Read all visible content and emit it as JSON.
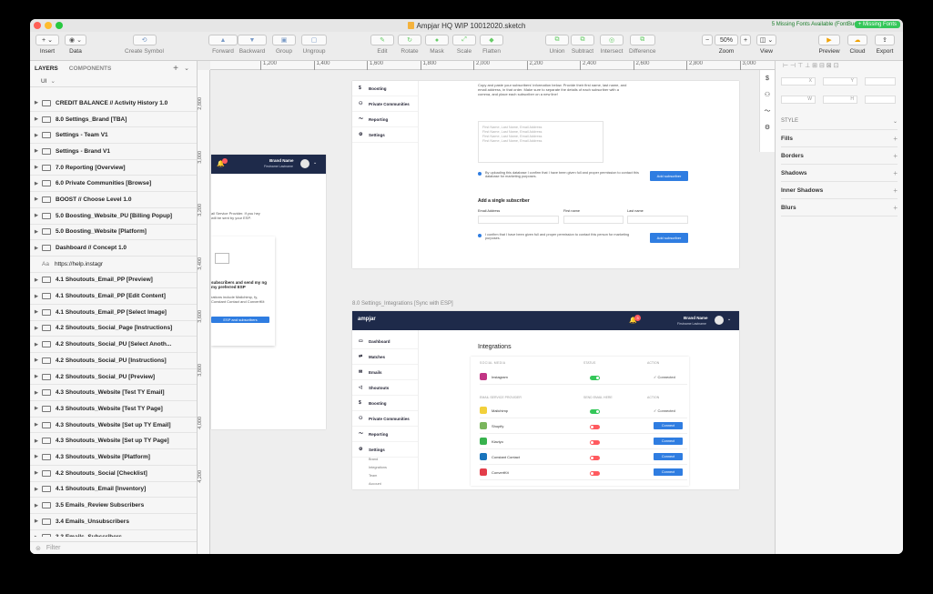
{
  "window": {
    "title": "Ampjar HQ WIP 10012020.sketch",
    "missing_fonts_text": "5 Missing Fonts Available (FontBuddy)",
    "missing_fonts_button": "+ Missing Fonts"
  },
  "toolbar": {
    "insert": "Insert",
    "data": "Data",
    "create_symbol": "Create Symbol",
    "forward": "Forward",
    "backward": "Backward",
    "group": "Group",
    "ungroup": "Ungroup",
    "edit": "Edit",
    "rotate": "Rotate",
    "mask": "Mask",
    "scale": "Scale",
    "flatten": "Flatten",
    "union": "Union",
    "subtract": "Subtract",
    "intersect": "Intersect",
    "difference": "Difference",
    "zoom_label": "Zoom",
    "zoom_value": "50%",
    "view": "View",
    "preview": "Preview",
    "cloud": "Cloud",
    "export": "Export"
  },
  "sidebar": {
    "tab_layers": "LAYERS",
    "tab_components": "COMPONENTS",
    "page": "UI",
    "filter_placeholder": "Filter",
    "layers": [
      {
        "name": "CREDIT BALANCE // Activity History 1.0",
        "type": "artboard"
      },
      {
        "name": "8.0 Settings_Brand [TBA]",
        "type": "artboard"
      },
      {
        "name": "Settings - Team V1",
        "type": "artboard"
      },
      {
        "name": "Settings - Brand V1",
        "type": "artboard"
      },
      {
        "name": "7.0 Reporting [Overview]",
        "type": "artboard"
      },
      {
        "name": "6.0 Private Communities [Browse]",
        "type": "artboard"
      },
      {
        "name": "BOOST // Choose Level 1.0",
        "type": "artboard"
      },
      {
        "name": "5.0 Boosting_Website_PU [Billing Popup]",
        "type": "artboard"
      },
      {
        "name": "5.0 Boosting_Website [Platform]",
        "type": "artboard"
      },
      {
        "name": "Dashboard // Concept 1.0",
        "type": "artboard"
      },
      {
        "name": "https://help.instagr",
        "type": "text"
      },
      {
        "name": "4.1 Shoutouts_Email_PP [Preview]",
        "type": "artboard"
      },
      {
        "name": "4.1 Shoutouts_Email_PP [Edit Content]",
        "type": "artboard"
      },
      {
        "name": "4.1 Shoutouts_Email_PP [Select Image]",
        "type": "artboard"
      },
      {
        "name": "4.2 Shoutouts_Social_Page [Instructions]",
        "type": "artboard"
      },
      {
        "name": "4.2 Shoutouts_Social_PU [Select Anoth...",
        "type": "artboard"
      },
      {
        "name": "4.2 Shoutouts_Social_PU [Instructions]",
        "type": "artboard"
      },
      {
        "name": "4.2 Shoutouts_Social_PU [Preview]",
        "type": "artboard"
      },
      {
        "name": "4.3 Shoutouts_Website [Test TY Email]",
        "type": "artboard"
      },
      {
        "name": "4.3 Shoutouts_Website [Test TY Page]",
        "type": "artboard"
      },
      {
        "name": "4.3 Shoutouts_Website [Set up TY Email]",
        "type": "artboard"
      },
      {
        "name": "4.3 Shoutouts_Website [Set up TY Page]",
        "type": "artboard"
      },
      {
        "name": "4.3 Shoutouts_Website [Platform]",
        "type": "artboard"
      },
      {
        "name": "4.2 Shoutouts_Social [Checklist]",
        "type": "artboard"
      },
      {
        "name": "4.1 Shoutouts_Email [Inventory]",
        "type": "artboard"
      },
      {
        "name": "3.5 Emails_Review Subscribers",
        "type": "artboard"
      },
      {
        "name": "3.4 Emails_Unsubscribers",
        "type": "artboard"
      },
      {
        "name": "3.3 Emails_Subscribers",
        "type": "artboard"
      }
    ]
  },
  "ruler": {
    "h_ticks": [
      "1,200",
      "1,400",
      "1,600",
      "1,800",
      "2,000",
      "2,200",
      "2,400",
      "2,600",
      "2,800",
      "3,000"
    ],
    "v_ticks": [
      "2,800",
      "3,000",
      "3,200",
      "3,400",
      "3,600",
      "3,800",
      "4,000",
      "4,200"
    ]
  },
  "artboards": {
    "left_frame": {
      "brand_name": "Brand Name",
      "brand_sub": "Firstname Lastname",
      "text_esp": "ail Service Provider. If you hey will be sent by your ESP.",
      "heading": "subscribers and send my ng my preferred ESP",
      "body": "rations include Mailchimp, fy, Constant Contact and ConvertKit",
      "cta": "ESP and subscribers"
    },
    "top_frame": {
      "nav": [
        "Boosting",
        "Private Communities",
        "Reporting",
        "Settings"
      ],
      "copy_paste_title": "Copy and paste",
      "instructions": "Copy and paste your subscribers' information below. Provide their first name, last name, and email address, in that order. Make sure to separate the details of each subscriber with a comma, and place each subscriber on a new line!",
      "textarea_lines": [
        "First Name, Last Name, Email Address",
        "First Name, Last Name, Email Address",
        "First Name, Last Name, Email Address",
        "First Name, Last Name, Email Address"
      ],
      "consent_1": "By uploading this database I confirm that I have been given full and proper permission to contact this database for marketing purposes.",
      "add_subscriber_btn": "Add subscriber",
      "single_title": "Add a single subscriber",
      "label_email": "Email Address",
      "label_first": "First name",
      "label_last": "Last name",
      "consent_2": "I confirm that I have been given full and proper permission to contact this person for marketing purposes.",
      "add_subscriber_btn_2": "Add subscriber"
    },
    "integrations_frame": {
      "artboard_title": "8.0 Settings_Integrations [Sync with ESP]",
      "logo": "ampjar",
      "notif_count": "3",
      "brand_name": "Brand Name",
      "brand_sub": "Firstname Lastname",
      "nav": [
        "Dashboard",
        "Matches",
        "Emails",
        "Shoutouts",
        "Boosting",
        "Private Communities",
        "Reporting",
        "Settings"
      ],
      "settings_sub": [
        "Brand",
        "Integrations",
        "Team",
        "Account"
      ],
      "heading": "Integrations",
      "social_header": "SOCIAL MEDIA",
      "status_header": "STATUS",
      "action_header": "ACTION",
      "esp_header": "EMAIL SERVICE PROVIDER",
      "send_header": "SEND EMAIL HERE",
      "action_header_2": "ACTION",
      "social": [
        {
          "name": "Instagram",
          "on": true,
          "action": "Connected",
          "color": "#c13584"
        }
      ],
      "esp": [
        {
          "name": "Mailchimp",
          "on": true,
          "action": "Connected",
          "color": "#f2d03b"
        },
        {
          "name": "Shopify",
          "on": false,
          "action": "Connect",
          "color": "#7ab55c"
        },
        {
          "name": "Klaviyo",
          "on": false,
          "action": "Connect",
          "color": "#37b24d"
        },
        {
          "name": "Constant Contact",
          "on": false,
          "action": "Connect",
          "color": "#1a75bc"
        },
        {
          "name": "ConvertKit",
          "on": false,
          "action": "Connect",
          "color": "#e33d4a"
        }
      ]
    }
  },
  "inspector": {
    "x_label": "X",
    "y_label": "Y",
    "w_label": "W",
    "h_label": "H",
    "style": "STYLE",
    "fills": "Fills",
    "borders": "Borders",
    "shadows": "Shadows",
    "inner_shadows": "Inner Shadows",
    "blurs": "Blurs"
  },
  "colors": {
    "app_header": "#1e2a4a",
    "accent_blue": "#2f7de1",
    "toggle_on": "#34c759",
    "toggle_off": "#ff5a5f"
  }
}
